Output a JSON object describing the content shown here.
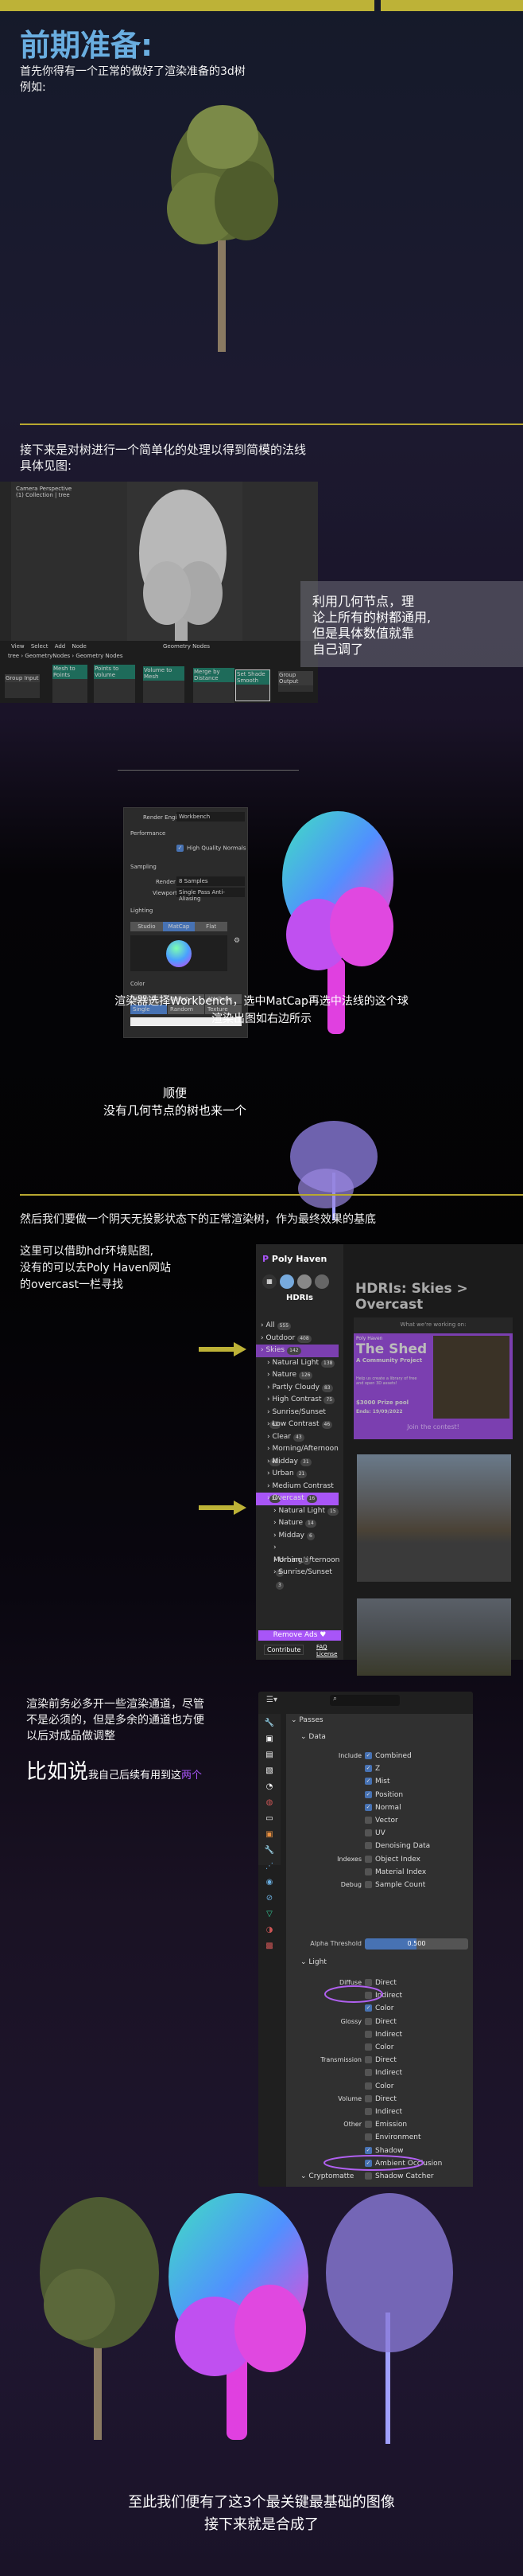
{
  "header": {
    "title": "前期准备:",
    "intro": [
      "首先你得有一个正常的做好了渲染准备的3d树",
      "例如:"
    ]
  },
  "section2": {
    "text": [
      "接下来是对树进行一个简单化的处理以得到简模的法线",
      "具体见图:"
    ],
    "annotation": [
      "利用几何节点，理",
      "论上所有的树都通用,",
      "但是具体数值就靠",
      "自己调了"
    ],
    "viewport": {
      "label1": "Camera Perspective",
      "label2": "(1) Collection | tree",
      "menu": [
        "View",
        "Select",
        "Add",
        "Node"
      ],
      "editor": "Geometry Nodes",
      "breadcrumb": [
        "tree",
        "GeometryNodes",
        "Geometry Nodes"
      ]
    },
    "nodes": [
      "Group Input",
      "Mesh to Points",
      "Points to Volume",
      "Volume to Mesh",
      "Merge by Distance",
      "Set Shade Smooth",
      "Group Output"
    ]
  },
  "section3": {
    "render_panel": {
      "engine_label": "Render Engine",
      "engine": "Workbench",
      "performance": "Performance",
      "hq_normals": "High Quality Normals",
      "sampling": "Sampling",
      "render_label": "Render",
      "render_value": "8 Samples",
      "viewport_label": "Viewport",
      "viewport_value": "Single Pass Anti-Aliasing",
      "lighting": "Lighting",
      "lighting_tabs": [
        "Studio",
        "MatCap",
        "Flat"
      ],
      "lighting_active": "MatCap",
      "color": "Color",
      "color_opts": [
        "Material",
        "Object",
        "Attribute",
        "Single",
        "Random",
        "Texture"
      ],
      "color_active": "Single"
    },
    "caption": [
      "渲染器选择Workbench，选中MatCap再选中法线的这个球",
      "渲染出图如右边所示"
    ],
    "side_note": [
      "顺便",
      "没有几何节点的树也来一个"
    ]
  },
  "section4": {
    "text": "然后我们要做一个阴天无投影状态下的正常渲染树，作为最终效果的基底",
    "left": [
      "这里可以借助hdr环境贴图,",
      "没有的可以去Poly Haven网站",
      "的overcast一栏寻找"
    ],
    "polyhaven": {
      "brand": "Poly Haven",
      "category": "HDRIs",
      "heading": "HDRIs: Skies > Overcast",
      "banner_top": "What we're working on:",
      "banner_brand": "Poly Haven",
      "banner_title": "The Shed",
      "banner_sub": "A Community Project",
      "banner_desc": "Help us create a library of free and open 3D assets!",
      "banner_prize": "$3000 Prize pool",
      "banner_ends": "Ends: 19/09/2022",
      "banner_cta": "Join the contest!",
      "items": [
        {
          "label": "All",
          "count": "555",
          "level": 0
        },
        {
          "label": "Outdoor",
          "count": "408",
          "level": 0
        },
        {
          "label": "Skies",
          "count": "142",
          "level": 0,
          "active": true
        },
        {
          "label": "Natural Light",
          "count": "138",
          "level": 1
        },
        {
          "label": "Nature",
          "count": "126",
          "level": 1
        },
        {
          "label": "Partly Cloudy",
          "count": "83",
          "level": 1
        },
        {
          "label": "High Contrast",
          "count": "75",
          "level": 1
        },
        {
          "label": "Sunrise/Sunset",
          "count": "61",
          "level": 1
        },
        {
          "label": "Low Contrast",
          "count": "46",
          "level": 1
        },
        {
          "label": "Clear",
          "count": "43",
          "level": 1
        },
        {
          "label": "Morning/Afternoon",
          "count": "42",
          "level": 1
        },
        {
          "label": "Midday",
          "count": "31",
          "level": 1
        },
        {
          "label": "Urban",
          "count": "21",
          "level": 1
        },
        {
          "label": "Medium Contrast",
          "count": "20",
          "level": 1
        },
        {
          "label": "Overcast",
          "count": "16",
          "level": 1,
          "active": true
        },
        {
          "label": "Natural Light",
          "count": "15",
          "level": 2
        },
        {
          "label": "Nature",
          "count": "14",
          "level": 2
        },
        {
          "label": "Midday",
          "count": "6",
          "level": 2
        },
        {
          "label": "Morning/Afternoon",
          "count": "5",
          "level": 2
        },
        {
          "label": "Urban",
          "count": "3",
          "level": 2
        },
        {
          "label": "Sunrise/Sunset",
          "count": "3",
          "level": 2
        }
      ],
      "remove_ads": "Remove Ads",
      "contribute": "Contribute",
      "faq": "FAQ",
      "license": "License"
    }
  },
  "section5": {
    "text": [
      "渲染前务必多开一些渲染通道，尽管",
      "不是必须的，但是多余的通道也方便",
      "以后对成品做调整"
    ],
    "big": "比如说",
    "rest": "我自己后续有用到这",
    "highlight": "两个",
    "passes": {
      "title": "Passes",
      "data": "Data",
      "light": "Light",
      "crypto": "Cryptomatte",
      "alpha_label": "Alpha Threshold",
      "alpha_value": "0.500",
      "alpha_fraction": 0.5,
      "rows": [
        {
          "group": "Include",
          "label": "Combined",
          "on": true
        },
        {
          "label": "Z",
          "on": true
        },
        {
          "label": "Mist",
          "on": true
        },
        {
          "label": "Position",
          "on": true
        },
        {
          "label": "Normal",
          "on": true
        },
        {
          "label": "Vector",
          "on": false
        },
        {
          "label": "UV",
          "on": false
        },
        {
          "label": "Denoising Data",
          "on": false
        },
        {
          "group": "Indexes",
          "label": "Object Index",
          "on": false
        },
        {
          "label": "Material Index",
          "on": false
        },
        {
          "group": "Debug",
          "label": "Sample Count",
          "on": false
        }
      ],
      "light_rows": [
        {
          "group": "Diffuse",
          "label": "Direct",
          "on": false
        },
        {
          "label": "Indirect",
          "on": false
        },
        {
          "label": "Color",
          "on": true
        },
        {
          "group": "Glossy",
          "label": "Direct",
          "on": false
        },
        {
          "label": "Indirect",
          "on": false
        },
        {
          "label": "Color",
          "on": false
        },
        {
          "group": "Transmission",
          "label": "Direct",
          "on": false
        },
        {
          "label": "Indirect",
          "on": false
        },
        {
          "label": "Color",
          "on": false
        },
        {
          "group": "Volume",
          "label": "Direct",
          "on": false
        },
        {
          "label": "Indirect",
          "on": false
        },
        {
          "group": "Other",
          "label": "Emission",
          "on": false
        },
        {
          "label": "Environment",
          "on": false
        },
        {
          "label": "Shadow",
          "on": true
        },
        {
          "label": "Ambient Occlusion",
          "on": true
        },
        {
          "label": "Shadow Catcher",
          "on": false
        }
      ]
    }
  },
  "footer": {
    "text": [
      "至此我们便有了这3个最关键最基础的图像",
      "接下来就是合成了"
    ]
  },
  "colors": {
    "accent_yellow": "#bdb237",
    "title_blue": "#6aaee0",
    "purple": "#a855f7",
    "blender_blue": "#4772b3"
  }
}
